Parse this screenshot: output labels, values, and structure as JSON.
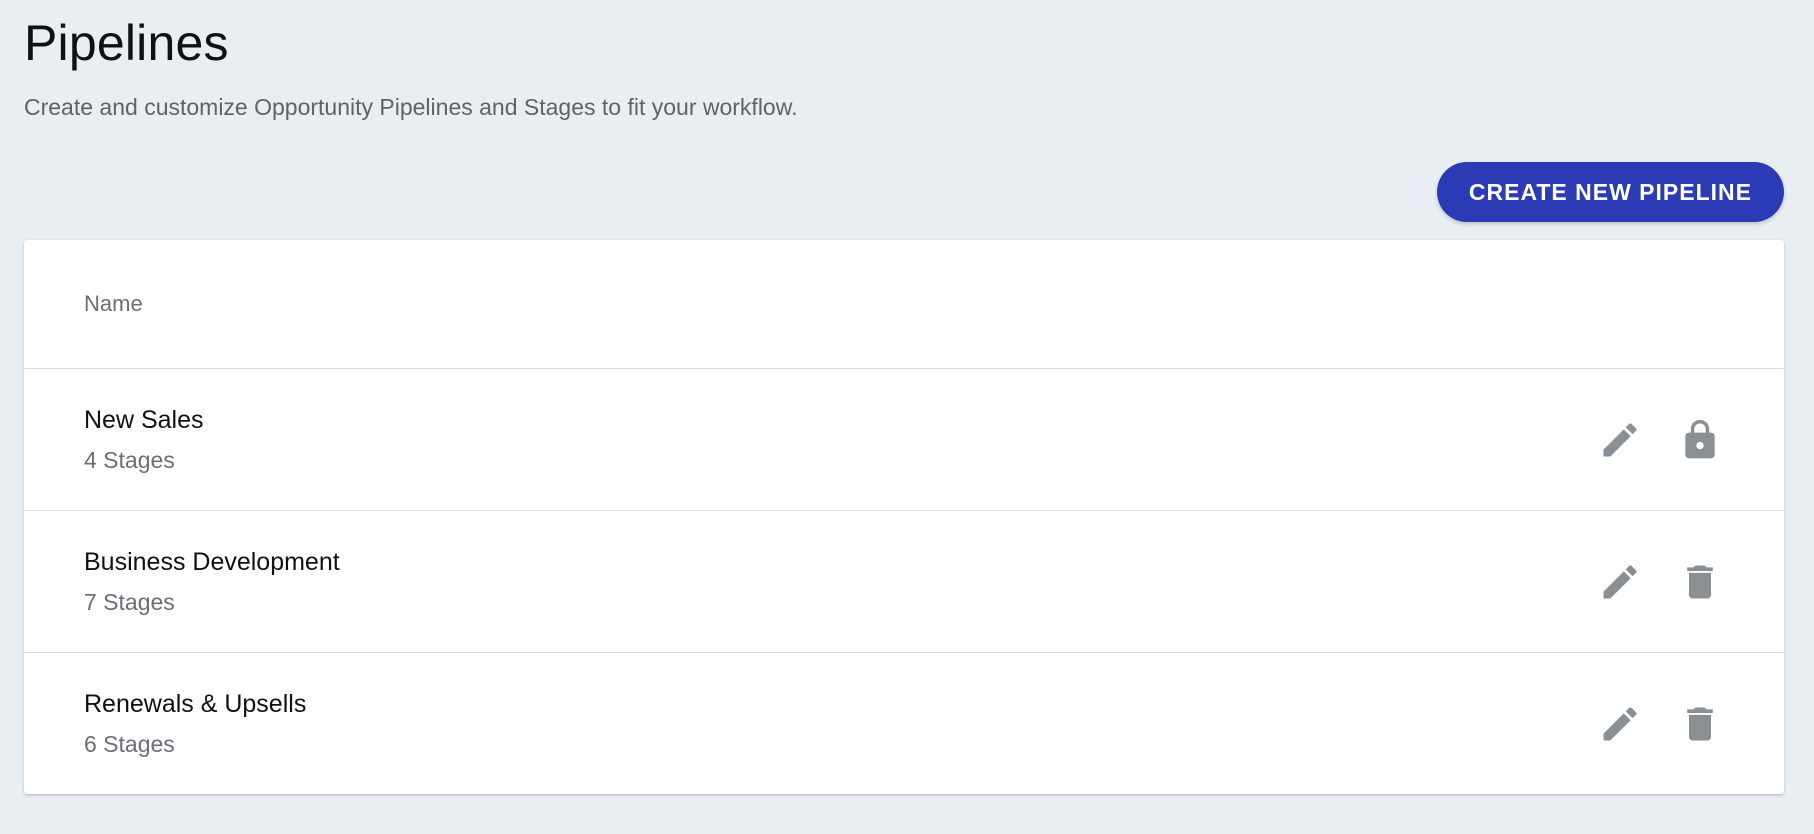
{
  "header": {
    "title": "Pipelines",
    "subtitle": "Create and customize Opportunity Pipelines and Stages to fit your workflow."
  },
  "toolbar": {
    "create_label": "CREATE NEW PIPELINE"
  },
  "table": {
    "columns": [
      "Name"
    ],
    "rows": [
      {
        "name": "New Sales",
        "stages": "4 Stages",
        "actions": [
          "pencil-icon",
          "lock-icon"
        ]
      },
      {
        "name": "Business Development",
        "stages": "7 Stages",
        "actions": [
          "pencil-icon",
          "trash-icon"
        ]
      },
      {
        "name": "Renewals & Upsells",
        "stages": "6 Stages",
        "actions": [
          "pencil-icon",
          "trash-icon"
        ]
      }
    ]
  },
  "colors": {
    "background": "#e9eef2",
    "primary_button": "#2b3ab5",
    "icon": "#8a8f93"
  }
}
